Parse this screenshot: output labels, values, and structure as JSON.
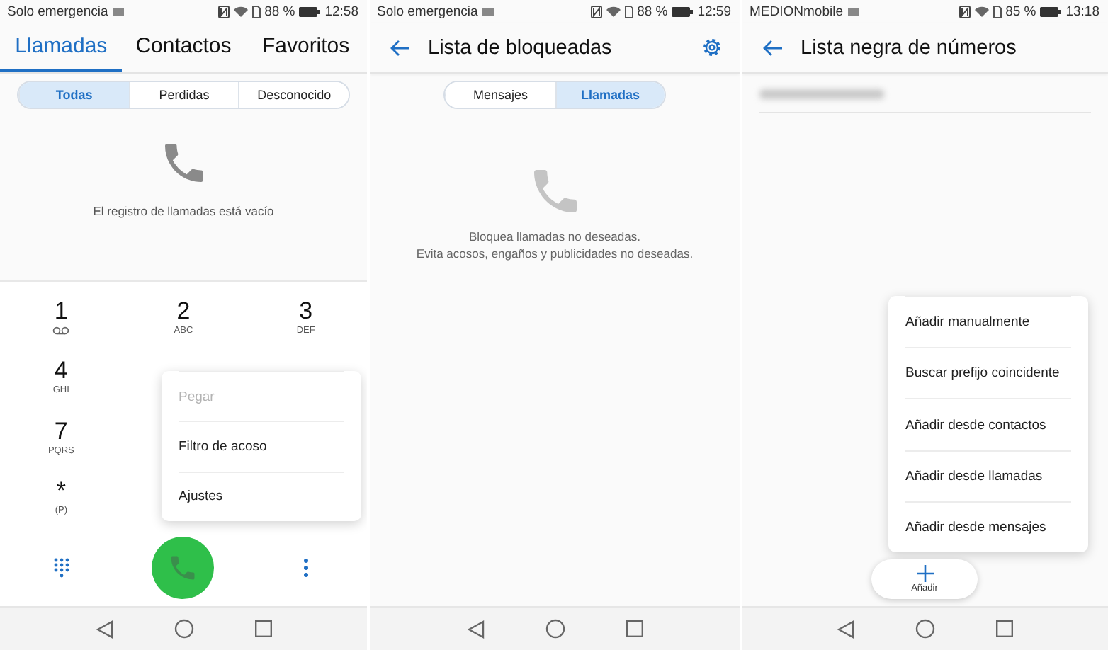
{
  "screens": [
    {
      "kind": "dialer",
      "status_bar": {
        "carrier": "Solo emergencia",
        "battery": "88 %",
        "time": "12:58"
      },
      "tabs": [
        {
          "label": "Llamadas",
          "selected": true
        },
        {
          "label": "Contactos",
          "selected": false
        },
        {
          "label": "Favoritos",
          "selected": false
        }
      ],
      "filters": [
        {
          "label": "Todas",
          "selected": true
        },
        {
          "label": "Perdidas",
          "selected": false
        },
        {
          "label": "Desconocido",
          "selected": false
        }
      ],
      "empty_message": "El registro de llamadas está vacío",
      "keypad": [
        [
          {
            "kind": "voicemail",
            "digit": "1"
          },
          {
            "kind": "letters",
            "digit": "2",
            "letters": "ABC"
          },
          {
            "kind": "letters",
            "digit": "3",
            "letters": "DEF"
          }
        ],
        [
          {
            "kind": "letters",
            "digit": "4",
            "letters": "GHI"
          }
        ],
        [
          {
            "kind": "letters",
            "digit": "7",
            "letters": "PQRS"
          }
        ],
        [
          {
            "kind": "letters",
            "digit": "*",
            "letters": "(P)"
          }
        ]
      ],
      "menu": [
        {
          "label": "Pegar",
          "disabled": true
        },
        {
          "label": "Filtro de acoso",
          "disabled": false
        },
        {
          "label": "Ajustes",
          "disabled": false
        }
      ]
    },
    {
      "kind": "blocked",
      "status_bar": {
        "carrier": "Solo emergencia",
        "battery": "88 %",
        "time": "12:59"
      },
      "title": "Lista de bloqueadas",
      "filters": [
        {
          "label": "Mensajes",
          "selected": false
        },
        {
          "label": "Llamadas",
          "selected": true
        }
      ],
      "empty_message": [
        "Bloquea llamadas no deseadas.",
        "Evita acosos, engaños y publicidades no deseadas."
      ]
    },
    {
      "kind": "blacklist",
      "status_bar": {
        "carrier": "MEDIONmobile",
        "battery": "85 %",
        "time": "13:18"
      },
      "title": "Lista negra de números",
      "menu": [
        {
          "label": "Añadir manualmente",
          "disabled": false
        },
        {
          "label": "Buscar prefijo coincidente",
          "disabled": false
        },
        {
          "label": "Añadir desde contactos",
          "disabled": false
        },
        {
          "label": "Añadir desde llamadas",
          "disabled": false
        },
        {
          "label": "Añadir desde mensajes",
          "disabled": false
        }
      ],
      "add_button": "Añadir"
    }
  ]
}
